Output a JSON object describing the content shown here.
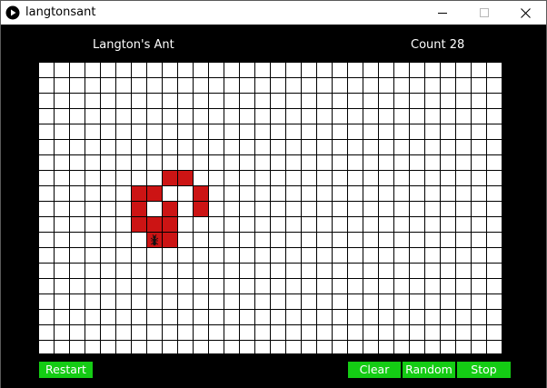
{
  "window": {
    "title": "langtonsant",
    "icon": "play-icon",
    "controls": [
      "minimize-icon",
      "maximize-icon",
      "close-icon"
    ]
  },
  "hud": {
    "title": "Langton's Ant",
    "count_label": "Count 28"
  },
  "grid": {
    "cols": 30,
    "rows": 19,
    "line_color": "#000000",
    "empty_color": "#ffffff",
    "filled_color": "#cc1414",
    "ant_color": "#cc1414",
    "filled_cells": [
      [
        8,
        7
      ],
      [
        9,
        7
      ],
      [
        6,
        8
      ],
      [
        7,
        8
      ],
      [
        10,
        8
      ],
      [
        6,
        9
      ],
      [
        8,
        9
      ],
      [
        10,
        9
      ],
      [
        6,
        10
      ],
      [
        7,
        10
      ],
      [
        8,
        10
      ],
      [
        8,
        11
      ]
    ],
    "ant": {
      "col": 7,
      "row": 11
    }
  },
  "buttons": {
    "restart": "Restart",
    "clear": "Clear",
    "random": "Random",
    "stop": "Stop",
    "color": "#14cc14"
  }
}
